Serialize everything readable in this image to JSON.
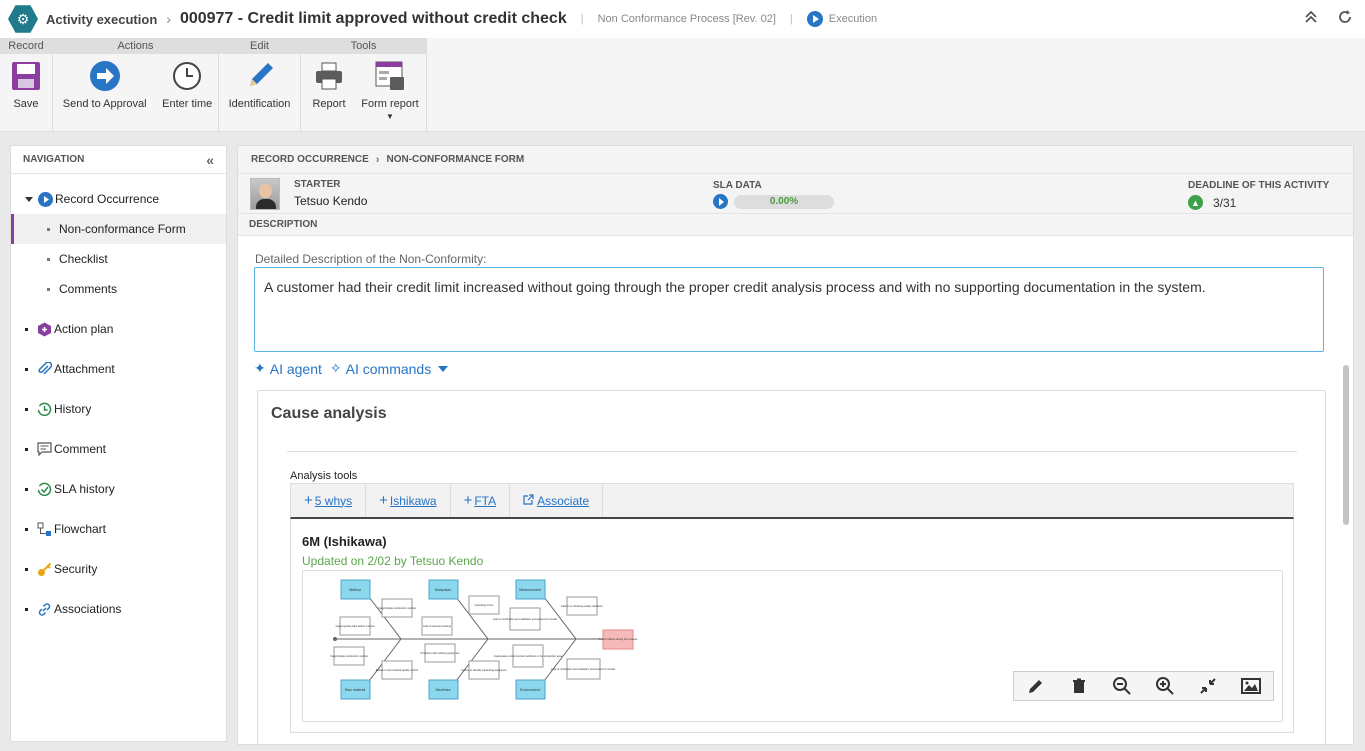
{
  "titlebar": {
    "app_name": "Activity execution",
    "record_title": "000977 - Credit limit approved without credit check",
    "process": "Non Conformance Process [Rev. 02]",
    "status": "Execution"
  },
  "ribbon": {
    "groups": {
      "record": "Record",
      "actions": "Actions",
      "edit": "Edit",
      "tools": "Tools"
    },
    "buttons": {
      "save": "Save",
      "send_to_approval": "Send to Approval",
      "enter_time": "Enter time",
      "identification": "Identification",
      "report": "Report",
      "form_report": "Form report"
    }
  },
  "navigation": {
    "title": "NAVIGATION",
    "items": [
      {
        "label": "Record Occurrence",
        "icon": "play-circle-icon"
      },
      {
        "label": "Non-conformance Form"
      },
      {
        "label": "Checklist"
      },
      {
        "label": "Comments"
      },
      {
        "label": "Action plan",
        "icon": "cube-icon"
      },
      {
        "label": "Attachment",
        "icon": "paperclip-icon"
      },
      {
        "label": "History",
        "icon": "history-icon"
      },
      {
        "label": "Comment",
        "icon": "comment-icon"
      },
      {
        "label": "SLA history",
        "icon": "sla-history-icon"
      },
      {
        "label": "Flowchart",
        "icon": "flowchart-icon"
      },
      {
        "label": "Security",
        "icon": "key-icon"
      },
      {
        "label": "Associations",
        "icon": "link-icon"
      }
    ]
  },
  "main": {
    "breadcrumb": [
      "RECORD OCCURRENCE",
      "NON-CONFORMANCE FORM"
    ],
    "starter_label": "STARTER",
    "starter_name": "Tetsuo Kendo",
    "sla_label": "SLA DATA",
    "sla_progress": "0.00%",
    "deadline_label": "DEADLINE OF THIS ACTIVITY",
    "deadline_value": "3/31",
    "description_header": "DESCRIPTION",
    "field_label": "Detailed Description of the Non-Conformity:",
    "field_value": "A customer had their credit limit increased without going through the proper credit analysis process and with no supporting documentation in the system.",
    "ai_agent": "AI agent",
    "ai_commands": "AI commands"
  },
  "cause_analysis": {
    "title": "Cause analysis",
    "tools_label": "Analysis tools",
    "tabs": [
      "5 whys",
      "Ishikawa",
      "FTA",
      "Associate"
    ],
    "tool_title": "6M (Ishikawa)",
    "tool_updated": "Updated on 2/02 by Tetsuo Kendo",
    "diagram": {
      "categories": [
        "Method",
        "Manpower",
        "Measurement",
        "Raw material",
        "Machines",
        "Environment"
      ],
      "effect": "Product failure during the process",
      "causes": [
        "Inappropriate production method",
        "Inappropriate plant admin method",
        "Inappropriate production method",
        "Failure in raw material quality control",
        "Lack of operator training",
        "Operating errors",
        "Problems with existing equipment",
        "Failure to identify measuring equipment",
        "Lack of verification and validation procedures for results",
        "Failure in checking quality indicators",
        "Inadequate environmental conditions in the production area",
        "Lack of verification and validation procedures for results"
      ]
    }
  }
}
